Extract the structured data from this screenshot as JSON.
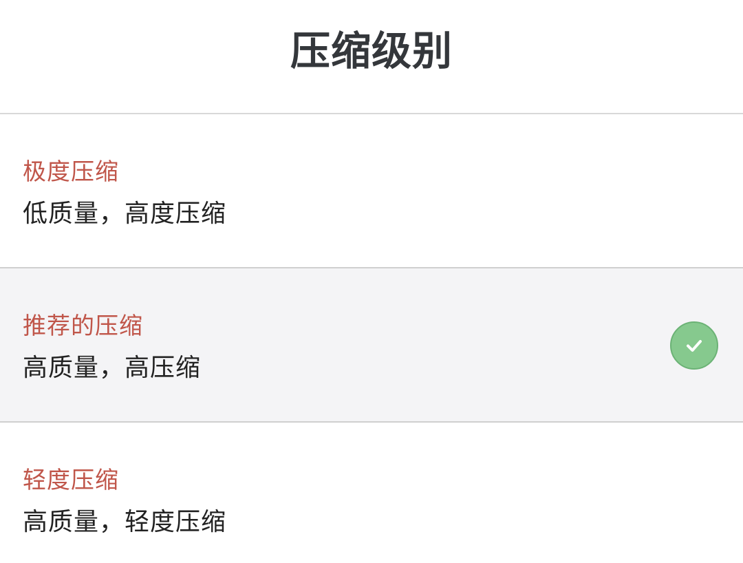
{
  "header": {
    "title": "压缩级别"
  },
  "options": [
    {
      "title": "极度压缩",
      "description": "低质量，高度压缩",
      "selected": false
    },
    {
      "title": "推荐的压缩",
      "description": "高质量，高压缩",
      "selected": true
    },
    {
      "title": "轻度压缩",
      "description": "高质量，轻度压缩",
      "selected": false
    }
  ],
  "icons": {
    "selected": "check-circle-icon"
  },
  "colors": {
    "option_title": "#c0564a",
    "check_fill": "#86c98e",
    "selected_bg": "#f4f4f6"
  }
}
